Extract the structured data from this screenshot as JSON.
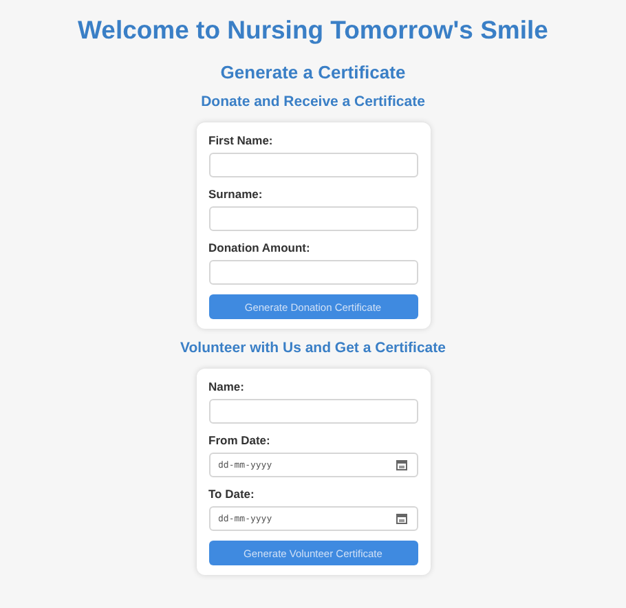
{
  "title": "Welcome to Nursing Tomorrow's Smile",
  "subtitle": "Generate a Certificate",
  "sections": [
    {
      "heading": "Donate and Receive a Certificate",
      "fields": [
        {
          "label": "First Name:",
          "kind": "text"
        },
        {
          "label": "Surname:",
          "kind": "text"
        },
        {
          "label": "Donation Amount:",
          "kind": "text"
        }
      ],
      "button": "Generate Donation Certificate"
    },
    {
      "heading": "Volunteer with Us and Get a Certificate",
      "fields": [
        {
          "label": "Name:",
          "kind": "text"
        },
        {
          "label": "From Date:",
          "kind": "date",
          "placeholder": "dd-mm-yyyy"
        },
        {
          "label": "To Date:",
          "kind": "date",
          "placeholder": "dd-mm-yyyy"
        }
      ],
      "button": "Generate Volunteer Certificate"
    }
  ]
}
